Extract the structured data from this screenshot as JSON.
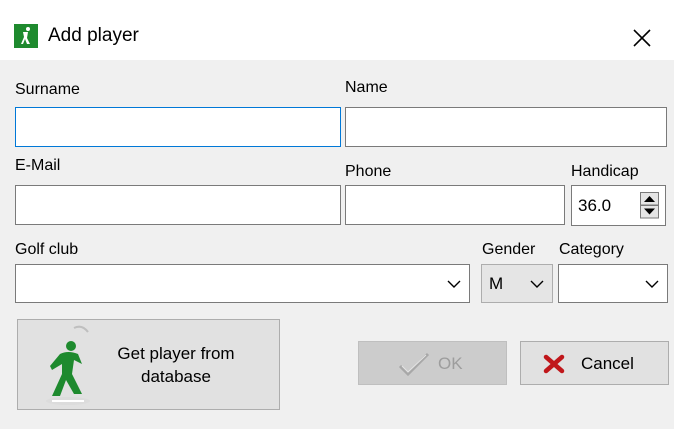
{
  "window": {
    "title": "Add player"
  },
  "form": {
    "surname": {
      "label": "Surname",
      "value": ""
    },
    "name": {
      "label": "Name",
      "value": ""
    },
    "email": {
      "label": "E-Mail",
      "value": ""
    },
    "phone": {
      "label": "Phone",
      "value": ""
    },
    "handicap": {
      "label": "Handicap",
      "value": "36.0"
    },
    "golf_club": {
      "label": "Golf club",
      "value": ""
    },
    "gender": {
      "label": "Gender",
      "value": "M"
    },
    "category": {
      "label": "Category",
      "value": ""
    }
  },
  "buttons": {
    "get_player_line1": "Get player from",
    "get_player_line2": "database",
    "ok": "OK",
    "cancel": "Cancel"
  },
  "icons": {
    "app": "golfer-icon",
    "close": "close-icon",
    "ok": "checkmark-icon",
    "cancel": "red-x-icon",
    "database": "golfer-swing-icon"
  },
  "colors": {
    "icon_green": "#1e8a2e",
    "focus_blue": "#0078d7",
    "cancel_red": "#c0171b"
  }
}
